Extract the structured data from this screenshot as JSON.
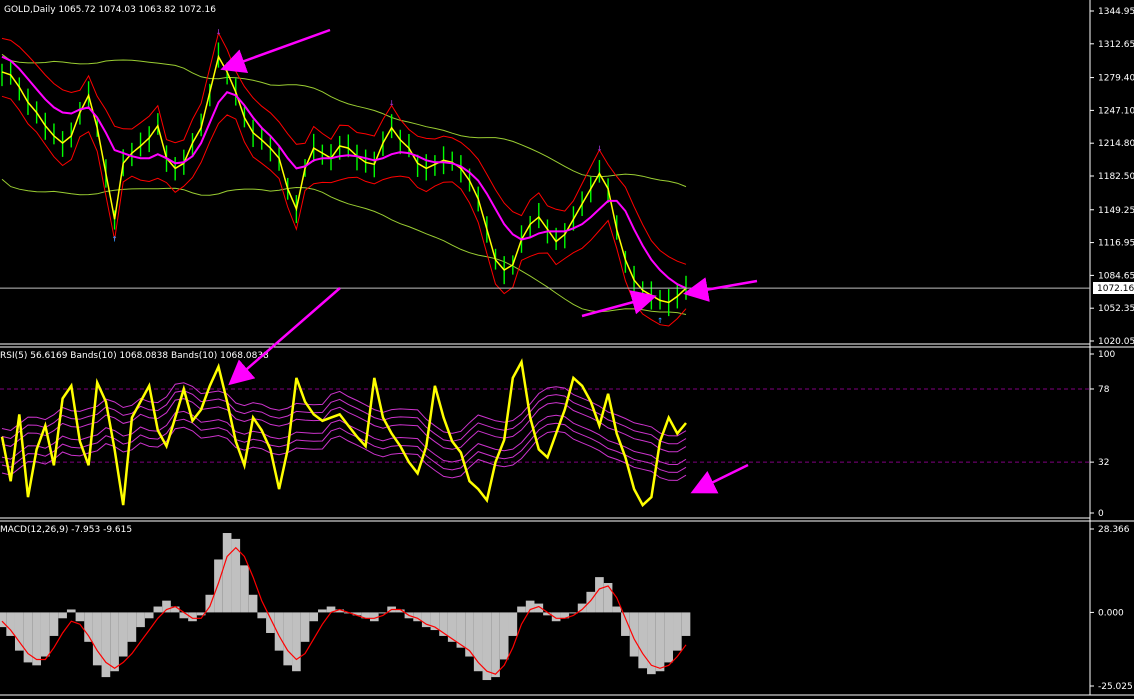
{
  "header": {
    "main_title": "GOLD,Daily  1065.72 1074.03 1063.82 1072.16",
    "rsi_title": "RSI(5) 56.6169  Bands(10) 1068.0838  Bands(10) 1068.0838",
    "macd_title": "MACD(12,26,9) -7.953 -9.615"
  },
  "price_label": "1072.16",
  "colors": {
    "background": "#000000",
    "candle": "#00ff00",
    "ma": "#ffff00",
    "ma_slow": "#ff00ff",
    "band_inner": "#ff0000",
    "band_outer": "#9acd32",
    "rsi": "#ffff00",
    "rsi_bands": "#cc33cc",
    "macd_hist": "#c0c0c0",
    "macd_signal": "#ff0000",
    "arrow": "#ff00ff",
    "axis": "#ffffff"
  },
  "chart_data": [
    {
      "type": "line",
      "panel": "price",
      "symbol": "GOLD",
      "timeframe": "Daily",
      "ohlc_last": [
        1065.72,
        1074.03,
        1063.82,
        1072.16
      ],
      "y_ticks": [
        1344.95,
        1312.65,
        1279.4,
        1247.1,
        1214.8,
        1182.5,
        1149.25,
        1116.95,
        1084.65,
        1052.35,
        1020.05
      ],
      "ylim": [
        1020.05,
        1344.95
      ],
      "series": [
        {
          "values": [
            1285,
            1282,
            1270,
            1255,
            1245,
            1232,
            1222,
            1215,
            1222,
            1245,
            1262,
            1230,
            1185,
            1140,
            1195,
            1205,
            1212,
            1220,
            1232,
            1200,
            1190,
            1195,
            1215,
            1230,
            1265,
            1300,
            1285,
            1265,
            1240,
            1225,
            1218,
            1210,
            1200,
            1170,
            1150,
            1190,
            1210,
            1205,
            1200,
            1212,
            1210,
            1202,
            1196,
            1194,
            1215,
            1230,
            1218,
            1210,
            1195,
            1190,
            1194,
            1198,
            1196,
            1190,
            1178,
            1160,
            1130,
            1100,
            1090,
            1095,
            1120,
            1135,
            1142,
            1130,
            1118,
            1125,
            1140,
            1155,
            1170,
            1185,
            1170,
            1130,
            1100,
            1080,
            1070,
            1065,
            1060,
            1058,
            1064,
            1072
          ]
        },
        {
          "values": [
            1300,
            1296,
            1288,
            1278,
            1268,
            1258,
            1250,
            1245,
            1244,
            1248,
            1250,
            1240,
            1225,
            1208,
            1205,
            1202,
            1200,
            1200,
            1204,
            1200,
            1195,
            1196,
            1202,
            1215,
            1235,
            1255,
            1265,
            1262,
            1252,
            1240,
            1230,
            1222,
            1212,
            1200,
            1190,
            1192,
            1198,
            1200,
            1200,
            1202,
            1203,
            1202,
            1200,
            1198,
            1200,
            1204,
            1206,
            1205,
            1202,
            1198,
            1196,
            1196,
            1195,
            1192,
            1186,
            1178,
            1165,
            1150,
            1135,
            1125,
            1120,
            1122,
            1126,
            1128,
            1128,
            1128,
            1131,
            1135,
            1142,
            1150,
            1158,
            1158,
            1148,
            1130,
            1114,
            1100,
            1090,
            1082,
            1076,
            1072
          ]
        }
      ]
    },
    {
      "type": "line",
      "panel": "rsi",
      "name": "RSI(5)",
      "value_last": 56.6169,
      "y_ticks": [
        100,
        78,
        32,
        0
      ],
      "ylim": [
        0,
        100
      ],
      "levels": [
        78,
        32
      ],
      "values": [
        48,
        20,
        62,
        10,
        40,
        55,
        30,
        72,
        80,
        45,
        30,
        82,
        70,
        40,
        5,
        60,
        70,
        80,
        52,
        42,
        60,
        78,
        58,
        65,
        80,
        92,
        70,
        45,
        30,
        60,
        52,
        40,
        15,
        40,
        85,
        70,
        62,
        58,
        60,
        62,
        55,
        48,
        42,
        85,
        60,
        50,
        42,
        32,
        25,
        42,
        80,
        60,
        45,
        38,
        20,
        15,
        8,
        32,
        46,
        85,
        95,
        60,
        40,
        35,
        50,
        65,
        85,
        80,
        70,
        55,
        75,
        50,
        35,
        15,
        5,
        10,
        45,
        60,
        50,
        56.6
      ]
    },
    {
      "type": "bar",
      "panel": "macd",
      "name": "MACD(12,26,9)",
      "macd_last": -7.953,
      "signal_last": -9.615,
      "y_ticks": [
        28.366,
        0.0,
        -25.025
      ],
      "ylim": [
        -25.025,
        28.366
      ],
      "histogram": [
        -5,
        -8,
        -13,
        -17,
        -18,
        -15,
        -8,
        -2,
        1,
        -3,
        -10,
        -18,
        -22,
        -20,
        -15,
        -10,
        -5,
        -2,
        2,
        4,
        2,
        -2,
        -3,
        -1,
        6,
        18,
        27,
        25,
        16,
        6,
        -2,
        -7,
        -13,
        -18,
        -20,
        -10,
        -3,
        1,
        2,
        1,
        0,
        -1,
        -2,
        -3,
        0,
        2,
        1,
        -2,
        -3,
        -5,
        -6,
        -8,
        -10,
        -12,
        -15,
        -20,
        -23,
        -22,
        -16,
        -8,
        2,
        4,
        3,
        -1,
        -3,
        -2,
        0,
        3,
        7,
        12,
        10,
        2,
        -8,
        -15,
        -19,
        -21,
        -20,
        -17,
        -13,
        -8
      ],
      "signal": [
        -3,
        -6,
        -10,
        -14,
        -16,
        -16,
        -12,
        -7,
        -3,
        -4,
        -8,
        -13,
        -17,
        -19,
        -17,
        -14,
        -10,
        -6,
        -2,
        1,
        2,
        0,
        -2,
        -2,
        2,
        10,
        19,
        22,
        19,
        12,
        4,
        -2,
        -8,
        -13,
        -16,
        -14,
        -9,
        -4,
        0,
        1,
        0,
        -1,
        -2,
        -2,
        -1,
        1,
        1,
        -1,
        -2,
        -4,
        -5,
        -7,
        -9,
        -11,
        -13,
        -17,
        -20,
        -21,
        -18,
        -12,
        -4,
        1,
        2,
        0,
        -2,
        -2,
        -1,
        1,
        4,
        8,
        9,
        5,
        -2,
        -9,
        -14,
        -18,
        -19,
        -18,
        -15,
        -11
      ]
    }
  ]
}
